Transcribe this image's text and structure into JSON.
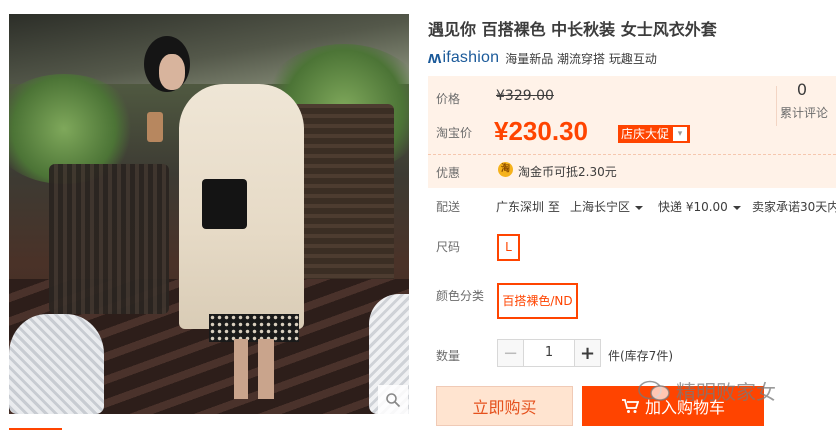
{
  "product": {
    "title": "遇见你 百搭裸色 中长秋装 女士风衣外套"
  },
  "brand": {
    "logo_text": "ifashion",
    "tags": "海量新品 潮流穿搭 玩趣互动"
  },
  "price": {
    "label": "价格",
    "original": "¥329.00",
    "tao_label": "淘宝价",
    "current": "¥230.30",
    "promo_badge": "店庆大促",
    "reviews_count": "0",
    "reviews_label": "累计评论"
  },
  "discount": {
    "label": "优惠",
    "coin_icon_text": "淘",
    "text": "淘金币可抵2.30元"
  },
  "shipping": {
    "label": "配送",
    "from": "广东深圳 至",
    "to": "上海长宁区",
    "fee": "快递 ¥10.00",
    "promise": "卖家承诺30天内"
  },
  "size": {
    "label": "尺码",
    "selected": "L"
  },
  "color": {
    "label": "颜色分类",
    "selected": "百搭裸色/ND"
  },
  "quantity": {
    "label": "数量",
    "value": "1",
    "minus": "−",
    "plus": "+",
    "stock": "件(库存7件)"
  },
  "actions": {
    "buy_now": "立即购买",
    "add_to_cart": "加入购物车"
  },
  "watermark": "精明败家女",
  "colors": {
    "accent": "#ff4400",
    "price_bg": "#fff2e8",
    "brand_blue": "#1b5a9a"
  }
}
